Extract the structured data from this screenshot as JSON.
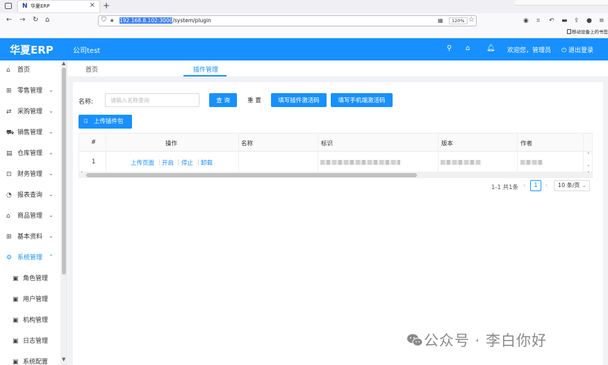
{
  "browser": {
    "tab_title": "华夏ERP",
    "tab_favicon": "N",
    "url_host": "192.168.8.102:3000",
    "url_path": "/system/plugin",
    "zoom": "120%",
    "mobile_bookmarks": "移动设备上的书签",
    "icons": [
      "back-icon",
      "forward-icon",
      "reload-icon",
      "home-icon",
      "shield-icon",
      "lock-icon",
      "star-icon"
    ]
  },
  "header": {
    "brand": "华夏ERP",
    "company": "公司test",
    "welcome": "欢迎您，管理员",
    "logout": "退出登录",
    "accent": "#1890ff"
  },
  "sidebar": {
    "items": [
      {
        "label": "首页",
        "icon": "⌂",
        "caret": ""
      },
      {
        "label": "零售管理",
        "icon": "⊞",
        "caret": "⌄"
      },
      {
        "label": "采购管理",
        "icon": "⇄",
        "caret": "⌄"
      },
      {
        "label": "销售管理",
        "icon": "⛟",
        "caret": "⌄"
      },
      {
        "label": "仓库管理",
        "icon": "▤",
        "caret": "⌄"
      },
      {
        "label": "财务管理",
        "icon": "⊡",
        "caret": "⌄"
      },
      {
        "label": "报表查询",
        "icon": "◔",
        "caret": "⌄"
      },
      {
        "label": "商品管理",
        "icon": "⌂",
        "caret": "⌄"
      },
      {
        "label": "基本资料",
        "icon": "⊞",
        "caret": "⌄"
      },
      {
        "label": "系统管理",
        "icon": "⚙",
        "caret": "⌃"
      }
    ],
    "subitems": [
      {
        "label": "角色管理",
        "icon": "▣"
      },
      {
        "label": "用户管理",
        "icon": "▣"
      },
      {
        "label": "机构管理",
        "icon": "▣"
      },
      {
        "label": "日志管理",
        "icon": "▣"
      },
      {
        "label": "系统配置",
        "icon": "▣"
      }
    ]
  },
  "content_tabs": [
    "首页",
    "插件管理"
  ],
  "search": {
    "label": "名称:",
    "placeholder": "请输入名称查询",
    "query_btn": "查 询",
    "reset_btn": "重 置",
    "activate_btn": "填写插件激活码",
    "mobile_activate_btn": "填写手机端激活码",
    "upload_btn": "上传插件包"
  },
  "table": {
    "headers": [
      "#",
      "操作",
      "名称",
      "标识",
      "版本",
      "作者"
    ],
    "rows": [
      {
        "index": "1",
        "actions": [
          "上传页面",
          "开启",
          "停止",
          "卸载"
        ]
      }
    ]
  },
  "pagination": {
    "total": "1-1 共1条",
    "current": "1",
    "page_size": "10 条/页"
  },
  "watermark": "公众号 · 李白你好"
}
